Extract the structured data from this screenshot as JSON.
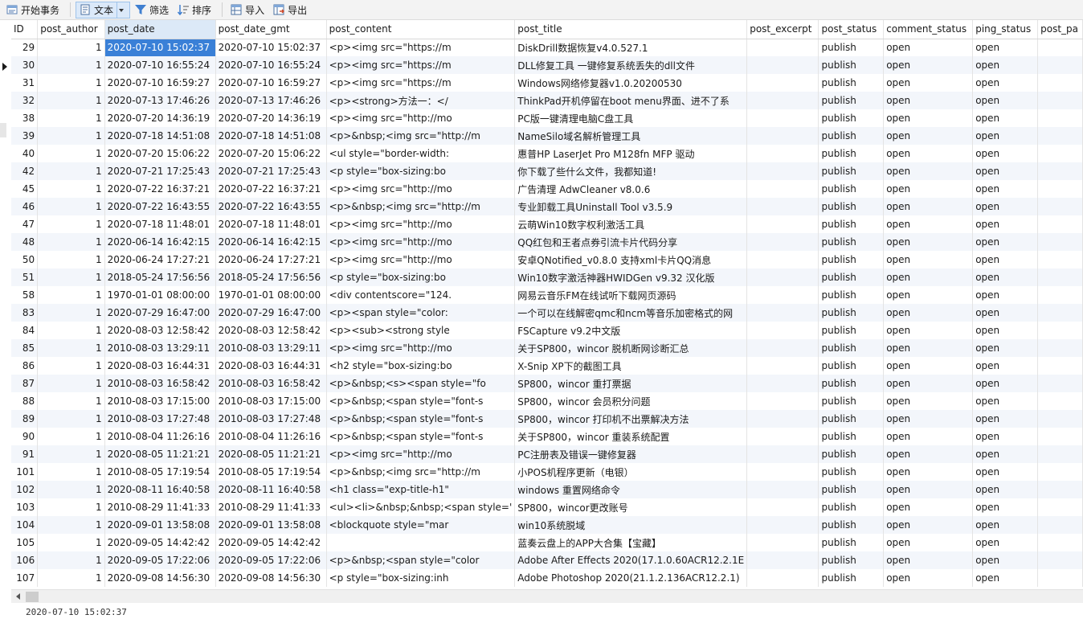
{
  "toolbar": {
    "begin_transaction": "开始事务",
    "text": "文本",
    "filter": "筛选",
    "sort": "排序",
    "import": "导入",
    "export": "导出"
  },
  "columns": [
    "ID",
    "post_author",
    "post_date",
    "post_date_gmt",
    "post_content",
    "post_title",
    "post_excerpt",
    "post_status",
    "comment_status",
    "ping_status",
    "post_pa"
  ],
  "rows": [
    [
      "29",
      "1",
      "2020-07-10 15:02:37",
      "2020-07-10 15:02:37",
      "<p><img src=\"https://m",
      "DiskDrill数据恢复v4.0.527.1",
      "",
      "publish",
      "open",
      "open",
      ""
    ],
    [
      "30",
      "1",
      "2020-07-10 16:55:24",
      "2020-07-10 16:55:24",
      "<p><img src=\"https://m",
      "DLL修复工具 一键修复系统丢失的dll文件",
      "",
      "publish",
      "open",
      "open",
      ""
    ],
    [
      "31",
      "1",
      "2020-07-10 16:59:27",
      "2020-07-10 16:59:27",
      "<p><img src=\"https://m",
      "Windows网络修复器v1.0.20200530",
      "",
      "publish",
      "open",
      "open",
      ""
    ],
    [
      "32",
      "1",
      "2020-07-13 17:46:26",
      "2020-07-13 17:46:26",
      "<p><strong>方法一：</",
      "ThinkPad开机停留在boot menu界面、进不了系",
      "",
      "publish",
      "open",
      "open",
      ""
    ],
    [
      "38",
      "1",
      "2020-07-20 14:36:19",
      "2020-07-20 14:36:19",
      "<p><img src=\"http://mo",
      "PC版一键清理电脑C盘工具",
      "",
      "publish",
      "open",
      "open",
      ""
    ],
    [
      "39",
      "1",
      "2020-07-18 14:51:08",
      "2020-07-18 14:51:08",
      "<p>&nbsp;<img src=\"http://m",
      "NameSilo域名解析管理工具",
      "",
      "publish",
      "open",
      "open",
      ""
    ],
    [
      "40",
      "1",
      "2020-07-20 15:06:22",
      "2020-07-20 15:06:22",
      "<ul style=\"border-width:",
      "惠普HP LaserJet Pro M128fn MFP 驱动",
      "",
      "publish",
      "open",
      "open",
      ""
    ],
    [
      "42",
      "1",
      "2020-07-21 17:25:43",
      "2020-07-21 17:25:43",
      "<p style=\"box-sizing:bo",
      "你下载了些什么文件，我都知道!",
      "",
      "publish",
      "open",
      "open",
      ""
    ],
    [
      "45",
      "1",
      "2020-07-22 16:37:21",
      "2020-07-22 16:37:21",
      "<p><img src=\"http://mo",
      "广告清理 AdwCleaner v8.0.6",
      "",
      "publish",
      "open",
      "open",
      ""
    ],
    [
      "46",
      "1",
      "2020-07-22 16:43:55",
      "2020-07-22 16:43:55",
      "<p>&nbsp;<img src=\"http://m",
      "专业卸载工具Uninstall Tool v3.5.9",
      "",
      "publish",
      "open",
      "open",
      ""
    ],
    [
      "47",
      "1",
      "2020-07-18 11:48:01",
      "2020-07-18 11:48:01",
      "<p><img src=\"http://mo",
      "云萌Win10数字权利激活工具",
      "",
      "publish",
      "open",
      "open",
      ""
    ],
    [
      "48",
      "1",
      "2020-06-14 16:42:15",
      "2020-06-14 16:42:15",
      "<p><img src=\"http://mo",
      "QQ红包和王者点券引流卡片代码分享",
      "",
      "publish",
      "open",
      "open",
      ""
    ],
    [
      "50",
      "1",
      "2020-06-24 17:27:21",
      "2020-06-24 17:27:21",
      "<p><img src=\"http://mo",
      "安卓QNotified_v0.8.0 支持xml卡片QQ消息",
      "",
      "publish",
      "open",
      "open",
      ""
    ],
    [
      "51",
      "1",
      "2018-05-24 17:56:56",
      "2018-05-24 17:56:56",
      "<p style=\"box-sizing:bo",
      "Win10数字激活神器HWIDGen v9.32 汉化版",
      "",
      "publish",
      "open",
      "open",
      ""
    ],
    [
      "58",
      "1",
      "1970-01-01 08:00:00",
      "1970-01-01 08:00:00",
      "<div contentscore=\"124.",
      "网易云音乐FM在线试听下载网页源码",
      "",
      "publish",
      "open",
      "open",
      ""
    ],
    [
      "83",
      "1",
      "2020-07-29 16:47:00",
      "2020-07-29 16:47:00",
      "<p><span style=\"color:",
      "一个可以在线解密qmc和ncm等音乐加密格式的网",
      "",
      "publish",
      "open",
      "open",
      ""
    ],
    [
      "84",
      "1",
      "2020-08-03 12:58:42",
      "2020-08-03 12:58:42",
      "<p><sub><strong style",
      "FSCapture v9.2中文版",
      "",
      "publish",
      "open",
      "open",
      ""
    ],
    [
      "85",
      "1",
      "2010-08-03 13:29:11",
      "2010-08-03 13:29:11",
      "<p><img src=\"http://mo",
      "关于SP800，wincor 脱机断网诊断汇总",
      "",
      "publish",
      "open",
      "open",
      ""
    ],
    [
      "86",
      "1",
      "2020-08-03 16:44:31",
      "2020-08-03 16:44:31",
      "<h2 style=\"box-sizing:bo",
      "X-Snip XP下的截图工具",
      "",
      "publish",
      "open",
      "open",
      ""
    ],
    [
      "87",
      "1",
      "2010-08-03 16:58:42",
      "2010-08-03 16:58:42",
      "<p>&nbsp;<s><span style=\"fo",
      "SP800，wincor 重打票据",
      "",
      "publish",
      "open",
      "open",
      ""
    ],
    [
      "88",
      "1",
      "2010-08-03 17:15:00",
      "2010-08-03 17:15:00",
      "<p>&nbsp;<span style=\"font-s",
      "SP800，wincor 会员积分问题",
      "",
      "publish",
      "open",
      "open",
      ""
    ],
    [
      "89",
      "1",
      "2010-08-03 17:27:48",
      "2010-08-03 17:27:48",
      "<p>&nbsp;<span style=\"font-s",
      "SP800，wincor 打印机不出票解决方法",
      "",
      "publish",
      "open",
      "open",
      ""
    ],
    [
      "90",
      "1",
      "2010-08-04 11:26:16",
      "2010-08-04 11:26:16",
      "<p>&nbsp;<span style=\"font-s",
      "关于SP800，wincor 重装系统配置",
      "",
      "publish",
      "open",
      "open",
      ""
    ],
    [
      "91",
      "1",
      "2020-08-05 11:21:21",
      "2020-08-05 11:21:21",
      "<p><img src=\"http://mo",
      "PC注册表及错误一键修复器",
      "",
      "publish",
      "open",
      "open",
      ""
    ],
    [
      "101",
      "1",
      "2010-08-05 17:19:54",
      "2010-08-05 17:19:54",
      "<p>&nbsp;<img src=\"http://m",
      "小POS机程序更新（电银）",
      "",
      "publish",
      "open",
      "open",
      ""
    ],
    [
      "102",
      "1",
      "2020-08-11 16:40:58",
      "2020-08-11 16:40:58",
      "<h1 class=\"exp-title-h1\"",
      "windows 重置网络命令",
      "",
      "publish",
      "open",
      "open",
      ""
    ],
    [
      "103",
      "1",
      "2010-08-29 11:41:33",
      "2010-08-29 11:41:33",
      "<ul><li>&nbsp;&nbsp;<span style='",
      "SP800，wincor更改账号",
      "",
      "publish",
      "open",
      "open",
      ""
    ],
    [
      "104",
      "1",
      "2020-09-01 13:58:08",
      "2020-09-01 13:58:08",
      "<blockquote style=\"mar",
      "win10系统脱域",
      "",
      "publish",
      "open",
      "open",
      ""
    ],
    [
      "105",
      "1",
      "2020-09-05 14:42:42",
      "2020-09-05 14:42:42",
      "",
      "蓝奏云盘上的APP大合集【宝藏】",
      "",
      "publish",
      "open",
      "open",
      ""
    ],
    [
      "106",
      "1",
      "2020-09-05 17:22:06",
      "2020-09-05 17:22:06",
      "<p>&nbsp;<span style=\"color",
      "Adobe After Effects 2020(17.1.0.60ACR12.2.1E",
      "",
      "publish",
      "open",
      "open",
      ""
    ],
    [
      "107",
      "1",
      "2020-09-08 14:56:30",
      "2020-09-08 14:56:30",
      "<p style=\"box-sizing:inh",
      "Adobe Photoshop 2020(21.1.2.136ACR12.2.1)",
      "",
      "publish",
      "open",
      "open",
      ""
    ]
  ],
  "statusbar": {
    "value": "2020-07-10 15:02:37"
  },
  "colors": {
    "selection": "#3a80d7",
    "header_selected": "#dce9f7",
    "row_alt": "#f3f6fb"
  },
  "icons": [
    "transaction-icon",
    "text-icon",
    "filter-icon",
    "sort-icon",
    "import-icon",
    "export-icon"
  ]
}
